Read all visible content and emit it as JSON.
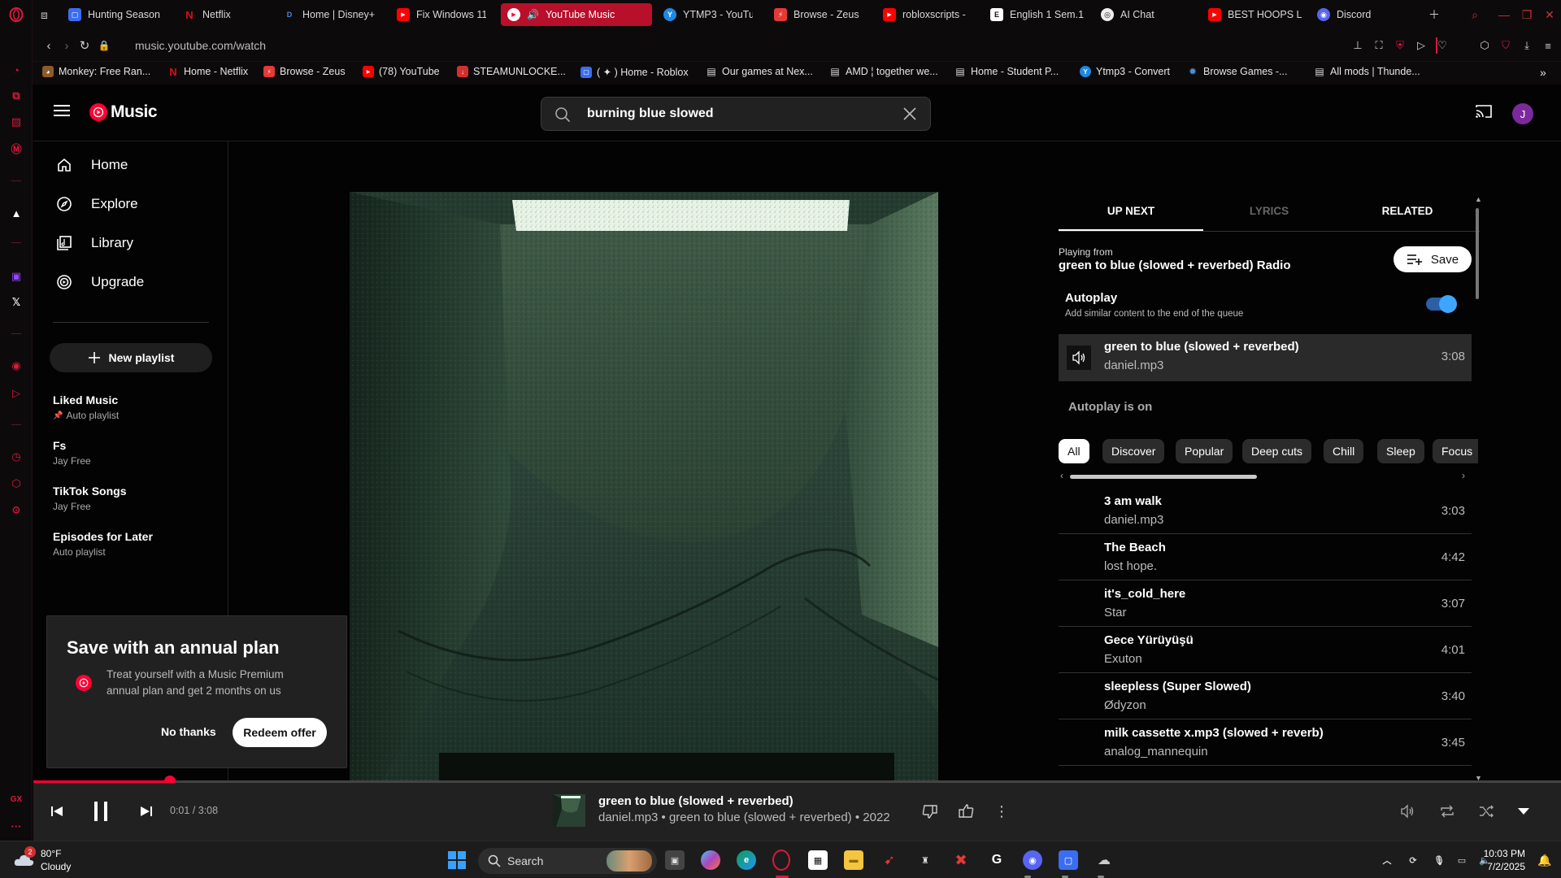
{
  "browser": {
    "tabs": [
      {
        "label": "Hunting Season",
        "fav_color": "#3b6df2",
        "fav": "▢"
      },
      {
        "label": "Netflix",
        "fav_color": "#e50914",
        "fav": "N"
      },
      {
        "label": "Home | Disney+",
        "fav_color": "#1a2a6c",
        "fav": "D"
      },
      {
        "label": "Fix Windows 11",
        "fav_color": "#ff0000",
        "fav": "▶"
      },
      {
        "label": "YouTube Music",
        "fav_color": "#ff0033",
        "fav": "▶"
      },
      {
        "label": "YTMP3 - YouTu",
        "fav_color": "#1e88e5",
        "fav": "Y"
      },
      {
        "label": "Browse - Zeus",
        "fav_color": "#e53935",
        "fav": "⚡"
      },
      {
        "label": "robloxscripts -",
        "fav_color": "#ff0000",
        "fav": "▶"
      },
      {
        "label": "English 1 Sem.1",
        "fav_color": "#ffffff",
        "fav": "E"
      },
      {
        "label": "AI Chat",
        "fav_color": "#333333",
        "fav": "◎"
      },
      {
        "label": "BEST HOOPS L",
        "fav_color": "#ff0000",
        "fav": "▶"
      },
      {
        "label": "Discord",
        "fav_color": "#5865f2",
        "fav": "◉"
      }
    ],
    "url": "music.youtube.com/watch",
    "bookmarks": [
      {
        "label": "Monkey: Free Ran...",
        "fav_color": "#8d5a2b",
        "fav": "◕"
      },
      {
        "label": "Home - Netflix",
        "fav_color": "#e50914",
        "fav": "N"
      },
      {
        "label": "Browse - Zeus",
        "fav_color": "#e53935",
        "fav": "⚡"
      },
      {
        "label": "(78) YouTube",
        "fav_color": "#ff0000",
        "fav": "▶"
      },
      {
        "label": "STEAMUNLOCKE...",
        "fav_color": "#d32f2f",
        "fav": "↓"
      },
      {
        "label": "( ✦ ) Home - Roblox",
        "fav_color": "#3b6df2",
        "fav": "▢"
      },
      {
        "label": "Our games at Nex...",
        "fav_color": "#dddddd",
        "fav": "▤"
      },
      {
        "label": "AMD ¦ together we...",
        "fav_color": "#dddddd",
        "fav": "▤"
      },
      {
        "label": "Home - Student P...",
        "fav_color": "#dddddd",
        "fav": "▤"
      },
      {
        "label": "Ytmp3 - Convert",
        "fav_color": "#1e88e5",
        "fav": "Y"
      },
      {
        "label": "Browse Games -...",
        "fav_color": "#4a90d9",
        "fav": "✹"
      },
      {
        "label": "All mods | Thunde...",
        "fav_color": "#dddddd",
        "fav": "▤"
      }
    ]
  },
  "ytm": {
    "logo_text": "Music",
    "search_query": "burning blue slowed",
    "avatar_letter": "J",
    "nav": [
      {
        "label": "Home",
        "icon": "home-icon"
      },
      {
        "label": "Explore",
        "icon": "compass-icon"
      },
      {
        "label": "Library",
        "icon": "library-icon"
      },
      {
        "label": "Upgrade",
        "icon": "upgrade-icon"
      }
    ],
    "new_playlist_label": "New playlist",
    "playlists": [
      {
        "title": "Liked Music",
        "subtitle": "Auto playlist",
        "pinned": true
      },
      {
        "title": "Fs",
        "subtitle": "Jay Free"
      },
      {
        "title": "TikTok Songs",
        "subtitle": "Jay Free"
      },
      {
        "title": "Episodes for Later",
        "subtitle": "Auto playlist"
      }
    ],
    "promo": {
      "title": "Save with an annual plan",
      "body": "Treat yourself with a Music Premium annual plan and get 2 months on us",
      "dismiss_label": "No thanks",
      "cta_label": "Redeem offer"
    },
    "panel": {
      "tabs": [
        "UP NEXT",
        "LYRICS",
        "RELATED"
      ],
      "playing_from_label": "Playing from",
      "playing_from_name": "green to blue (slowed + reverbed) Radio",
      "save_label": "Save",
      "autoplay_title": "Autoplay",
      "autoplay_desc": "Add similar content to the end of the queue",
      "autoplay_enabled": true,
      "current": {
        "title": "green to blue (slowed + reverbed)",
        "artist": "daniel.mp3",
        "duration": "3:08"
      },
      "autoplay_on_label": "Autoplay is on",
      "chips": [
        "All",
        "Discover",
        "Popular",
        "Deep cuts",
        "Chill",
        "Sleep",
        "Focus"
      ],
      "selected_chip": "All",
      "queue": [
        {
          "title": "3 am walk",
          "artist": "daniel.mp3",
          "duration": "3:03"
        },
        {
          "title": "The Beach",
          "artist": "lost hope.",
          "duration": "4:42"
        },
        {
          "title": "it's_cold_here",
          "artist": "Star",
          "duration": "3:07"
        },
        {
          "title": "Gece Yürüyüşü",
          "artist": "Exuton",
          "duration": "4:01"
        },
        {
          "title": "sleepless (Super Slowed)",
          "artist": "Ødyzon",
          "duration": "3:40"
        },
        {
          "title": "milk cassette x.mp3 (slowed + reverb)",
          "artist": "analog_mannequin",
          "duration": "3:45"
        }
      ]
    },
    "player": {
      "time": "0:01 / 3:08",
      "progress": 0.005,
      "title": "green to blue (slowed + reverbed)",
      "subtitle": "daniel.mp3 • green to blue (slowed + reverbed) • 2022"
    }
  },
  "taskbar": {
    "temperature": "80°F",
    "condition": "Cloudy",
    "weather_badge": "2",
    "search_label": "Search",
    "time": "10:03 PM",
    "date": "7/2/2025"
  },
  "colors": {
    "accent": "#ff0033",
    "opera_red": "#d81a3c",
    "active_tab": "#b8102b"
  }
}
